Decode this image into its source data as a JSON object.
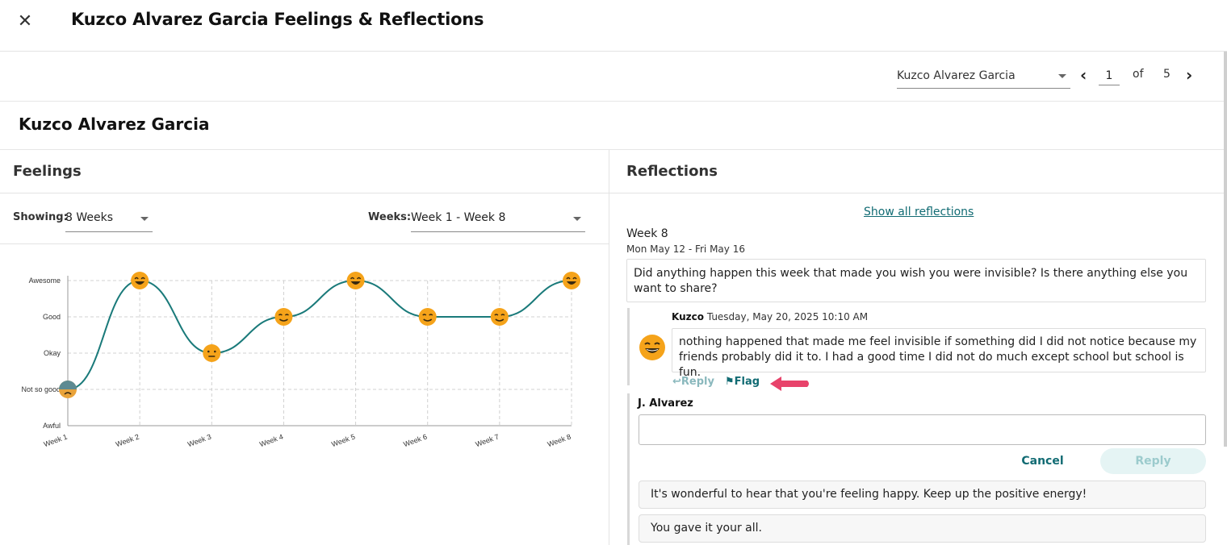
{
  "app": {
    "title": "Kuzco Alvarez Garcia Feelings & Reflections"
  },
  "nav": {
    "student": "Kuzco Alvarez Garcia",
    "page": "1",
    "of_label": "of",
    "total_pages": "5"
  },
  "student_name": "Kuzco Alvarez Garcia",
  "feelings": {
    "title": "Feelings",
    "showing_label": "Showing:",
    "showing_value": "8 Weeks",
    "weeks_label": "Weeks:",
    "weeks_value": "Week 1 - Week 8"
  },
  "chart_data": {
    "type": "line",
    "categories": [
      "Week 1",
      "Week 2",
      "Week 3",
      "Week 4",
      "Week 5",
      "Week 6",
      "Week 7",
      "Week 8"
    ],
    "y_levels": [
      "Awful",
      "Not so good",
      "Okay",
      "Good",
      "Awesome"
    ],
    "values": [
      1,
      4,
      2,
      3,
      4,
      3,
      3,
      4
    ],
    "ylim": [
      0,
      4
    ],
    "grid": true,
    "line_color": "#1a7a7a",
    "emoji_color": "#f5a31a"
  },
  "reflections": {
    "title": "Reflections",
    "show_all": "Show all reflections",
    "week": "Week 8",
    "dates": "Mon May 12 - Fri May 16",
    "question": "Did anything happen this week that made you wish you were invisible? Is there anything else you want to share?",
    "response_author": "Kuzco",
    "response_time": "Tuesday, May 20, 2025 10:10 AM",
    "response_text": "nothing happened that made me feel invisible if something did I did not notice because my friends probably did it to. I had a good time I did not do much except school but school is fun.",
    "reply_link": "Reply",
    "flag_link": "Flag",
    "teacher": "J. Alvarez",
    "cancel": "Cancel",
    "reply": "Reply",
    "suggestions": [
      "It's wonderful to hear that you're feeling happy. Keep up the positive energy!",
      "You gave it your all."
    ]
  }
}
